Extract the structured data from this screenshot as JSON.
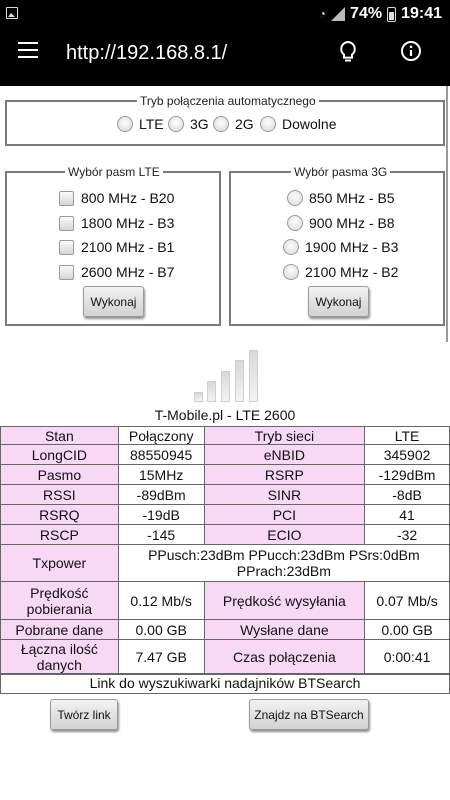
{
  "status_bar": {
    "battery": "74%",
    "time": "19:41"
  },
  "app_bar": {
    "url": "http://192.168.8.1/"
  },
  "mode": {
    "legend": "Tryb połączenia automatycznego",
    "options": [
      "LTE",
      "3G",
      "2G",
      "Dowolne"
    ]
  },
  "lte_bands": {
    "legend": "Wybór pasm LTE",
    "options": [
      "800 MHz - B20",
      "1800 MHz - B3",
      "2100 MHz - B1",
      "2600 MHz - B7"
    ],
    "button": "Wykonaj"
  },
  "bands_3g": {
    "legend": "Wybór pasma 3G",
    "options": [
      "850 MHz - B5",
      "900 MHz - B8",
      "1900 MHz - B3",
      "2100 MHz - B2"
    ],
    "button": "Wykonaj"
  },
  "network_label": "T-Mobile.pl - LTE 2600",
  "table": {
    "rows": [
      [
        "Stan",
        "Połączony",
        "Tryb sieci",
        "LTE"
      ],
      [
        "LongCID",
        "88550945",
        "eNBID",
        "345902"
      ],
      [
        "Pasmo",
        "15MHz",
        "RSRP",
        "-129dBm"
      ],
      [
        "RSSI",
        "-89dBm",
        "SINR",
        "-8dB"
      ],
      [
        "RSRQ",
        "-19dB",
        "PCI",
        "41"
      ],
      [
        "RSCP",
        "-145",
        "ECIO",
        "-32"
      ]
    ],
    "txpower_label": "Txpower",
    "txpower_value": "PPusch:23dBm PPucch:23dBm PSrs:0dBm PPrach:23dBm",
    "download_label": "Prędkość pobierania",
    "download_value": "0.12 Mb/s",
    "upload_label": "Prędkość wysyłania",
    "upload_value": "0.07 Mb/s",
    "downloaded_label": "Pobrane dane",
    "downloaded_value": "0.00 GB",
    "sent_label": "Wysłane dane",
    "sent_value": "0.00 GB",
    "total_label": "Łączna ilość danych",
    "total_value": "7.47 GB",
    "time_label": "Czas połączenia",
    "time_value": "0:00:41"
  },
  "btsearch": {
    "link_text": "Link do wyszukiwarki nadajników BTSearch",
    "create_button": "Twórz link",
    "find_button": "Znajdz na BTSearch"
  },
  "colors": {
    "label_bg": "#f7d8f5",
    "bar_bg": "#000000"
  }
}
